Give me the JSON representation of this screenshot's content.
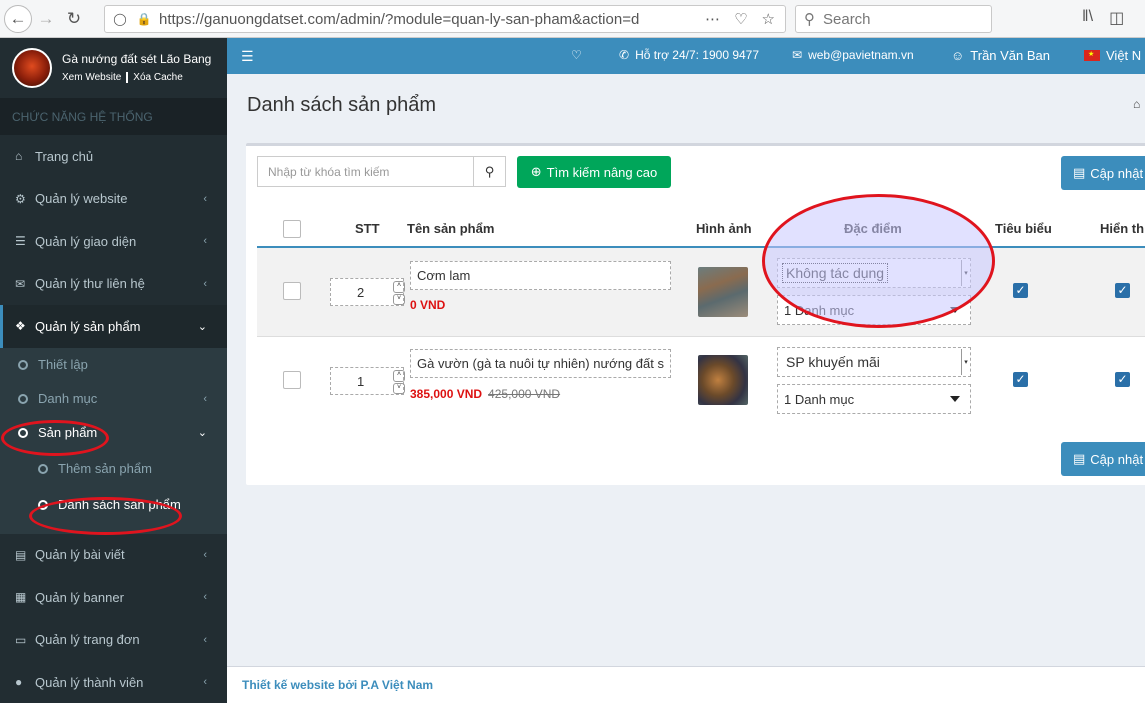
{
  "browser": {
    "url": "https://ganuongdatset.com/admin/?module=quan-ly-san-pham&action=d",
    "search_placeholder": "Search"
  },
  "sidebar": {
    "site_name": "Gà nướng đất sét Lão Bang",
    "view_site": "Xem Website",
    "clear_cache": "Xóa Cache",
    "section": "CHỨC NĂNG HỆ THỐNG",
    "items": [
      {
        "label": "Trang chủ",
        "icon": "home-icon"
      },
      {
        "label": "Quản lý website",
        "icon": "cogs-icon"
      },
      {
        "label": "Quản lý giao diện",
        "icon": "bars-icon"
      },
      {
        "label": "Quản lý thư liên hệ",
        "icon": "envelope-icon"
      },
      {
        "label": "Quản lý sản phẩm",
        "icon": "cubes-icon"
      }
    ],
    "product_sub": [
      "Thiết lập",
      "Danh mục",
      "Sản phẩm"
    ],
    "product_subsub": [
      "Thêm sản phẩm",
      "Danh sách sản phẩm"
    ],
    "items_after": [
      {
        "label": "Quản lý bài viết",
        "icon": "newspaper-icon"
      },
      {
        "label": "Quản lý banner",
        "icon": "image-icon"
      },
      {
        "label": "Quản lý trang đơn",
        "icon": "laptop-icon"
      },
      {
        "label": "Quản lý thành viên",
        "icon": "user-icon"
      }
    ]
  },
  "header": {
    "support": "Hỗ trợ 24/7: 1900 9477",
    "email": "web@pavietnam.vn",
    "user": "Trần Văn Ban",
    "language": "Việt N"
  },
  "page": {
    "title": "Danh sách sản phẩm",
    "search_placeholder": "Nhập từ khóa tìm kiếm",
    "advanced_search": "Tìm kiếm nâng cao",
    "save": "Cập nhật"
  },
  "table": {
    "columns": [
      "STT",
      "Tên sản phẩm",
      "Hình ảnh",
      "Đặc điểm",
      "Tiêu biểu",
      "Hiển th"
    ],
    "rows": [
      {
        "stt": "2",
        "name": "Cơm lam",
        "price": "0 VND",
        "old_price": "",
        "feature": "Không tác dụng",
        "category": "1 Danh mục",
        "featured": true,
        "visible": true
      },
      {
        "stt": "1",
        "name": "Gà vườn (gà ta nuôi tự nhiên) nướng đất s",
        "price": "385,000 VND",
        "old_price": "425,000 VND",
        "feature": "SP khuyến mãi",
        "category": "1 Danh mục",
        "featured": true,
        "visible": true
      }
    ]
  },
  "footer": {
    "text": "Thiết kế website bởi P.A Việt Nam"
  }
}
